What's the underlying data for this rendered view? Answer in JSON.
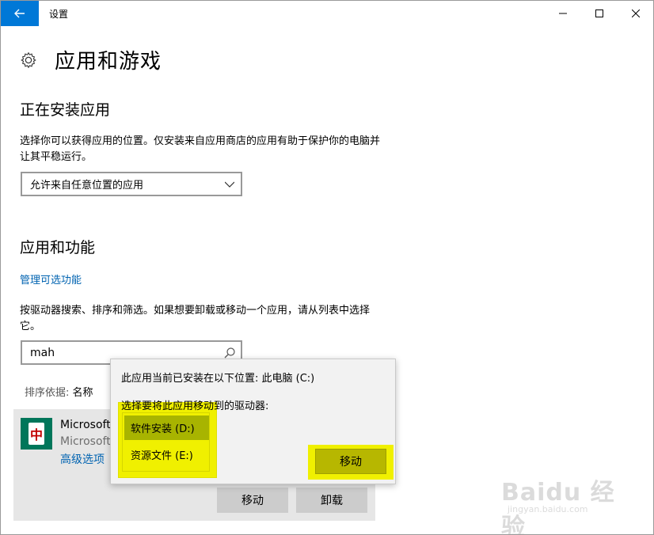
{
  "window": {
    "title": "设置",
    "controls": {
      "minimize_icon": "minimize-icon",
      "maximize_icon": "maximize-icon",
      "close_icon": "close-icon"
    },
    "back_icon": "back-arrow-icon",
    "accent_color": "#0078d7"
  },
  "header": {
    "icon": "gear-icon",
    "title": "应用和游戏"
  },
  "install_section": {
    "heading": "正在安装应用",
    "description": "选择你可以获得应用的位置。仅安装来自应用商店的应用有助于保护你的电脑并让其平稳运行。",
    "dropdown_value": "允许来自任意位置的应用"
  },
  "apps_section": {
    "heading": "应用和功能",
    "manage_link": "管理可选功能",
    "description": "按驱动器搜索、排序和筛选。如果想要卸载或移动一个应用，请从列表中选择它。",
    "search_value": "mah",
    "sort_label": "排序依据: ",
    "sort_value": "名称",
    "app": {
      "name": "Microsoft",
      "publisher": "Microsoft",
      "advanced_options": "高级选项",
      "icon_glyph": "中"
    },
    "buttons": {
      "move": "移动",
      "uninstall": "卸载"
    }
  },
  "move_popup": {
    "current_location": "此应用当前已安装在以下位置: 此电脑 (C:)",
    "choose_drive": "选择要将此应用移动到的驱动器:",
    "drives": [
      "软件安装 (D:)",
      "资源文件 (E:)"
    ],
    "move_button": "移动",
    "highlight_color": "#f0f000"
  },
  "watermark": {
    "brand": "Baidu 经验",
    "url": "jingyan.baidu.com"
  }
}
